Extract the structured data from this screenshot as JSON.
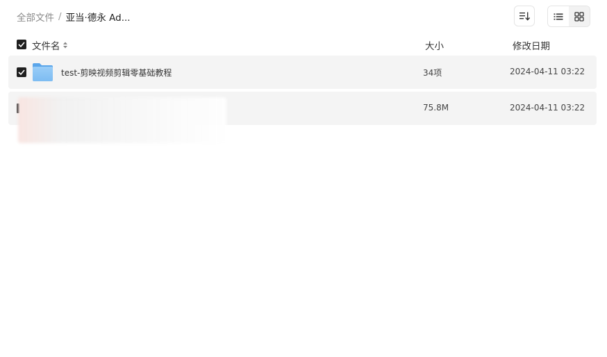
{
  "breadcrumb": {
    "root": "全部文件",
    "separator": "/",
    "current": "亚当·德永 Ad..."
  },
  "toolbar": {
    "sort_icon": "sort-icon",
    "list_view_icon": "list-view-icon",
    "grid_view_icon": "grid-view-icon",
    "selected_view": "list"
  },
  "table": {
    "columns": {
      "name": "文件名",
      "size": "大小",
      "date": "修改日期"
    },
    "rows": [
      {
        "type": "folder",
        "name": "test-剪映视频剪辑零基础教程",
        "size": "34项",
        "date": "2024-04-11 03:22",
        "checked": true
      },
      {
        "type": "file",
        "name": "",
        "size": "75.8M",
        "date": "2024-04-11 03:22",
        "checked": true
      }
    ]
  },
  "colors": {
    "row_bg": "#f4f4f4",
    "checkbox": "#1f1f1f",
    "folder": "#6fb2ef"
  }
}
